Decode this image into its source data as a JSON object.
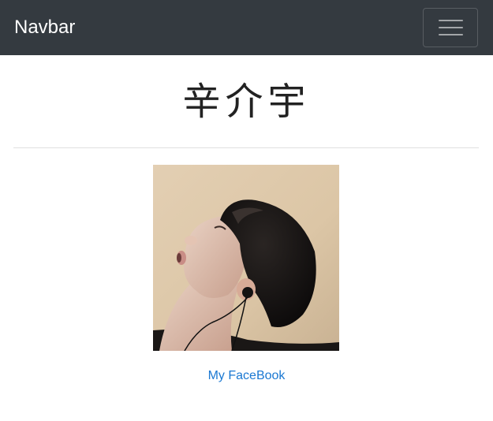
{
  "navbar": {
    "brand": "Navbar",
    "background": "#343a40",
    "toggler_icon": "hamburger-menu-icon"
  },
  "main": {
    "title": "辛介宇",
    "photo_description": "",
    "link_label": "My FaceBook",
    "link_color": "#1a78d2"
  }
}
